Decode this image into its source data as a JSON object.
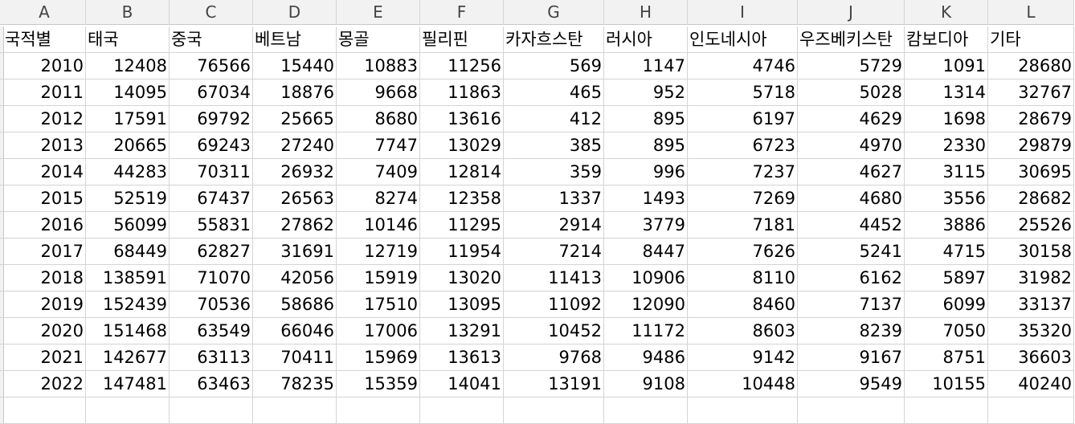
{
  "columns": [
    "A",
    "B",
    "C",
    "D",
    "E",
    "F",
    "G",
    "H",
    "I",
    "J",
    "K",
    "L"
  ],
  "header_row": [
    "국적별",
    "태국",
    "중국",
    "베트남",
    "몽골",
    "필리핀",
    "카자흐스탄",
    "러시아",
    "인도네시아",
    "우즈베키스탄",
    "캄보디아",
    "기타"
  ],
  "rows": [
    [
      "2010",
      "12408",
      "76566",
      "15440",
      "10883",
      "11256",
      "569",
      "1147",
      "4746",
      "5729",
      "1091",
      "28680"
    ],
    [
      "2011",
      "14095",
      "67034",
      "18876",
      "9668",
      "11863",
      "465",
      "952",
      "5718",
      "5028",
      "1314",
      "32767"
    ],
    [
      "2012",
      "17591",
      "69792",
      "25665",
      "8680",
      "13616",
      "412",
      "895",
      "6197",
      "4629",
      "1698",
      "28679"
    ],
    [
      "2013",
      "20665",
      "69243",
      "27240",
      "7747",
      "13029",
      "385",
      "895",
      "6723",
      "4970",
      "2330",
      "29879"
    ],
    [
      "2014",
      "44283",
      "70311",
      "26932",
      "7409",
      "12814",
      "359",
      "996",
      "7237",
      "4627",
      "3115",
      "30695"
    ],
    [
      "2015",
      "52519",
      "67437",
      "26563",
      "8274",
      "12358",
      "1337",
      "1493",
      "7269",
      "4680",
      "3556",
      "28682"
    ],
    [
      "2016",
      "56099",
      "55831",
      "27862",
      "10146",
      "11295",
      "2914",
      "3779",
      "7181",
      "4452",
      "3886",
      "25526"
    ],
    [
      "2017",
      "68449",
      "62827",
      "31691",
      "12719",
      "11954",
      "7214",
      "8447",
      "7626",
      "5241",
      "4715",
      "30158"
    ],
    [
      "2018",
      "138591",
      "71070",
      "42056",
      "15919",
      "13020",
      "11413",
      "10906",
      "8110",
      "6162",
      "5897",
      "31982"
    ],
    [
      "2019",
      "152439",
      "70536",
      "58686",
      "17510",
      "13095",
      "11092",
      "12090",
      "8460",
      "7137",
      "6099",
      "33137"
    ],
    [
      "2020",
      "151468",
      "63549",
      "66046",
      "17006",
      "13291",
      "10452",
      "11172",
      "8603",
      "8239",
      "7050",
      "35320"
    ],
    [
      "2021",
      "142677",
      "63113",
      "70411",
      "15969",
      "13613",
      "9768",
      "9486",
      "9142",
      "9167",
      "8751",
      "36603"
    ],
    [
      "2022",
      "147481",
      "63463",
      "78235",
      "15359",
      "14041",
      "13191",
      "9108",
      "10448",
      "9549",
      "10155",
      "40240"
    ]
  ]
}
